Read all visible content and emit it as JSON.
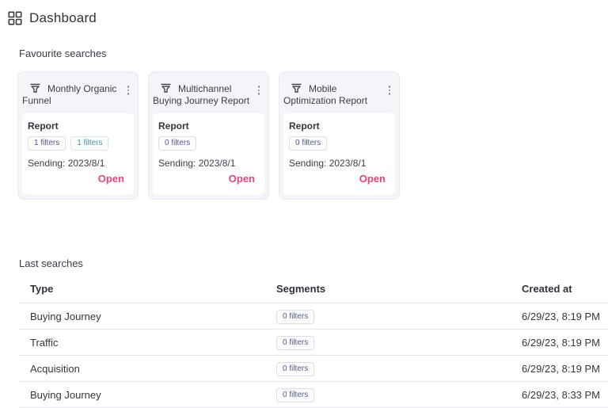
{
  "header": {
    "title": "Dashboard",
    "icon": "grid-icon"
  },
  "colors": {
    "accent_pink": "#ea4376",
    "badge_purple": "#55558c",
    "badge_teal": "#409da6",
    "card_background": "#f4f4f9",
    "divider": "#e7e7ec"
  },
  "favourites": {
    "heading": "Favourite searches",
    "cards": [
      {
        "icon": "funnel-icon",
        "title": "Monthly Organic Funnel",
        "type": "Report",
        "badges": [
          {
            "label": "1 filters",
            "style": "purple"
          },
          {
            "label": "1 filters",
            "style": "teal"
          }
        ],
        "sending": "Sending: 2023/8/1",
        "open_label": "Open",
        "menu_icon": "kebab-icon"
      },
      {
        "icon": "funnel-icon",
        "title": "Multichannel Buying Journey Report",
        "type": "Report",
        "badges": [
          {
            "label": "0 filters",
            "style": "purple"
          }
        ],
        "sending": "Sending: 2023/8/1",
        "open_label": "Open",
        "menu_icon": "kebab-icon"
      },
      {
        "icon": "funnel-icon",
        "title": "Mobile Optimization Report",
        "type": "Report",
        "badges": [
          {
            "label": "0 filters",
            "style": "purple"
          }
        ],
        "sending": "Sending: 2023/8/1",
        "open_label": "Open",
        "menu_icon": "kebab-icon"
      }
    ]
  },
  "last_searches": {
    "heading": "Last searches",
    "columns": [
      "Type",
      "Segments",
      "Created at"
    ],
    "rows": [
      {
        "type": "Buying Journey",
        "segments": "0 filters",
        "created_at": "6/29/23, 8:19 PM"
      },
      {
        "type": "Traffic",
        "segments": "0 filters",
        "created_at": "6/29/23, 8:19 PM"
      },
      {
        "type": "Acquisition",
        "segments": "0 filters",
        "created_at": "6/29/23, 8:19 PM"
      },
      {
        "type": "Buying Journey",
        "segments": "0 filters",
        "created_at": "6/29/23, 8:33 PM"
      }
    ]
  }
}
